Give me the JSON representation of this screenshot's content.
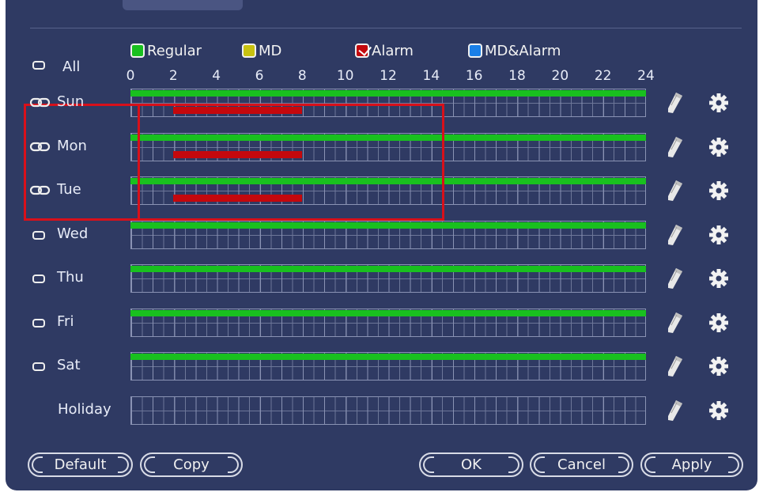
{
  "legend": {
    "regular": {
      "label": "Regular",
      "color": "#19c01f"
    },
    "md": {
      "label": "MD",
      "color": "#c8c210"
    },
    "alarm": {
      "label": "Alarm",
      "color": "#c4080d",
      "checked": true
    },
    "md_alarm": {
      "label": "MD&Alarm",
      "color": "#1a7fe8"
    }
  },
  "all_label": "All",
  "hours": [
    "0",
    "2",
    "4",
    "6",
    "8",
    "10",
    "12",
    "14",
    "16",
    "18",
    "20",
    "22",
    "24"
  ],
  "days": [
    {
      "label": "Sun",
      "linked": true,
      "regular": [
        0,
        24
      ],
      "alarm": [
        2,
        8
      ]
    },
    {
      "label": "Mon",
      "linked": true,
      "regular": [
        0,
        24
      ],
      "alarm": [
        2,
        8
      ]
    },
    {
      "label": "Tue",
      "linked": true,
      "regular": [
        0,
        24
      ],
      "alarm": [
        2,
        8
      ]
    },
    {
      "label": "Wed",
      "linked": false,
      "regular": [
        0,
        24
      ],
      "alarm": null
    },
    {
      "label": "Thu",
      "linked": false,
      "regular": [
        0,
        24
      ],
      "alarm": null
    },
    {
      "label": "Fri",
      "linked": false,
      "regular": [
        0,
        24
      ],
      "alarm": null
    },
    {
      "label": "Sat",
      "linked": false,
      "regular": [
        0,
        24
      ],
      "alarm": null
    },
    {
      "label": "Holiday",
      "linked": null,
      "regular": null,
      "alarm": null
    }
  ],
  "buttons": {
    "default": "Default",
    "copy": "Copy",
    "ok": "OK",
    "cancel": "Cancel",
    "apply": "Apply"
  },
  "row_icons": [
    "pencil-icon",
    "gear-icon"
  ]
}
